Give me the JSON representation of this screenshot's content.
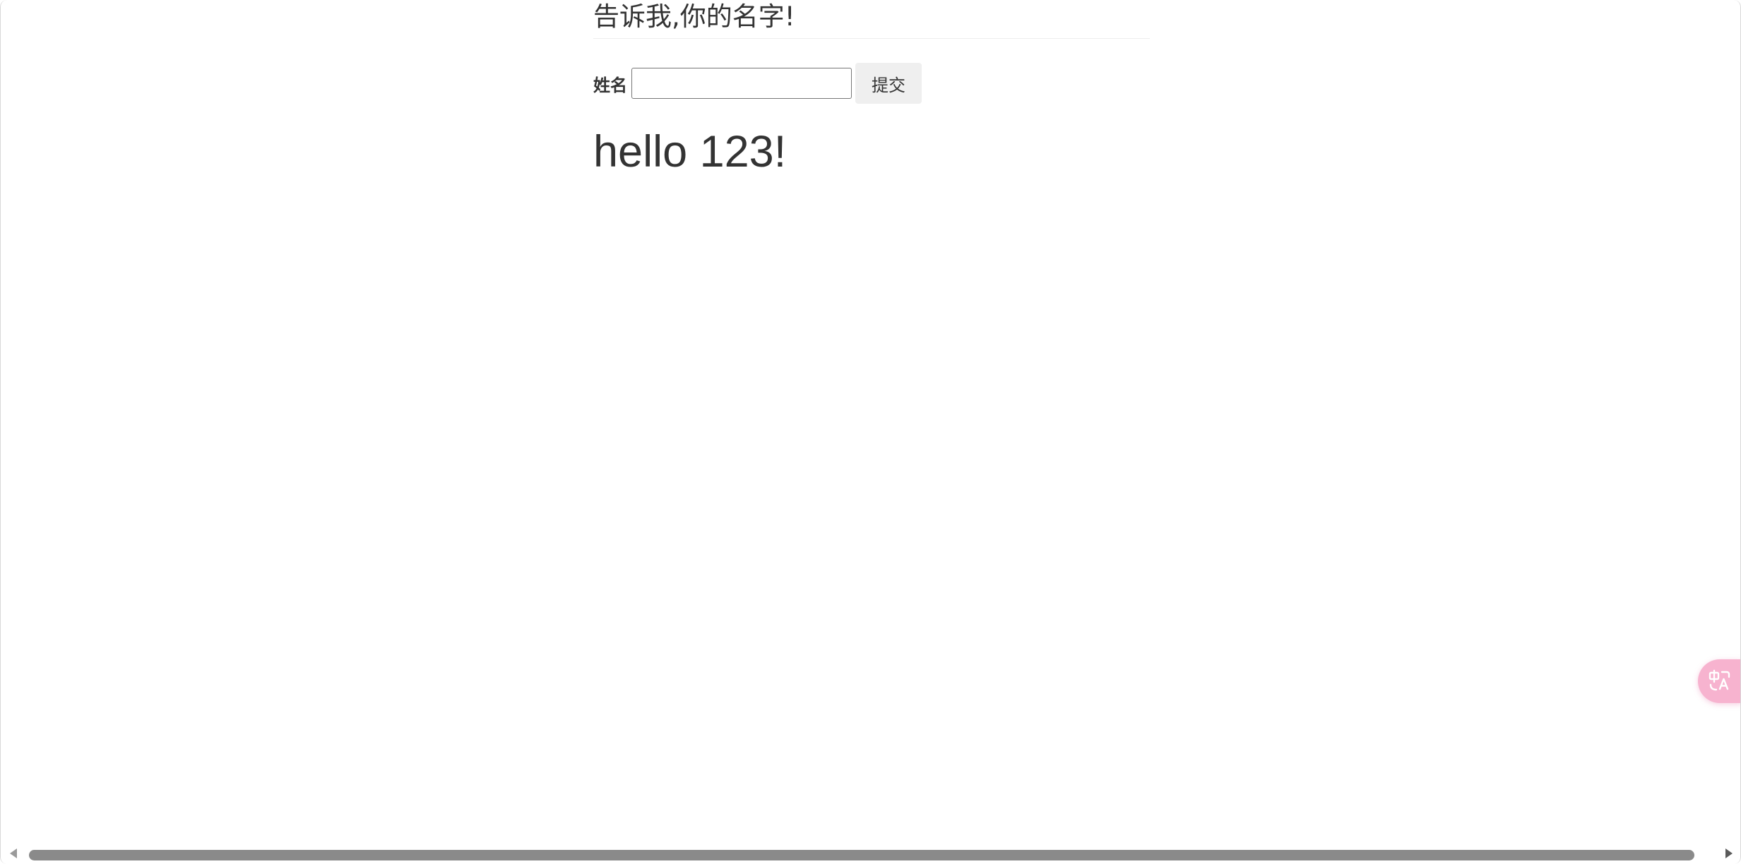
{
  "page": {
    "title": "告诉我,你的名字!"
  },
  "form": {
    "name_label": "姓名",
    "name_input_value": "",
    "name_input_placeholder": "",
    "submit_label": "提交"
  },
  "greeting": {
    "text": "hello 123!"
  },
  "widgets": {
    "translate_icon": "translate-icon",
    "translate_color": "#f7b3cf"
  },
  "scrollbar": {
    "left_arrow_icon": "triangle-left-icon",
    "right_arrow_icon": "triangle-right-icon",
    "thumb_color": "#8a8a8a"
  }
}
